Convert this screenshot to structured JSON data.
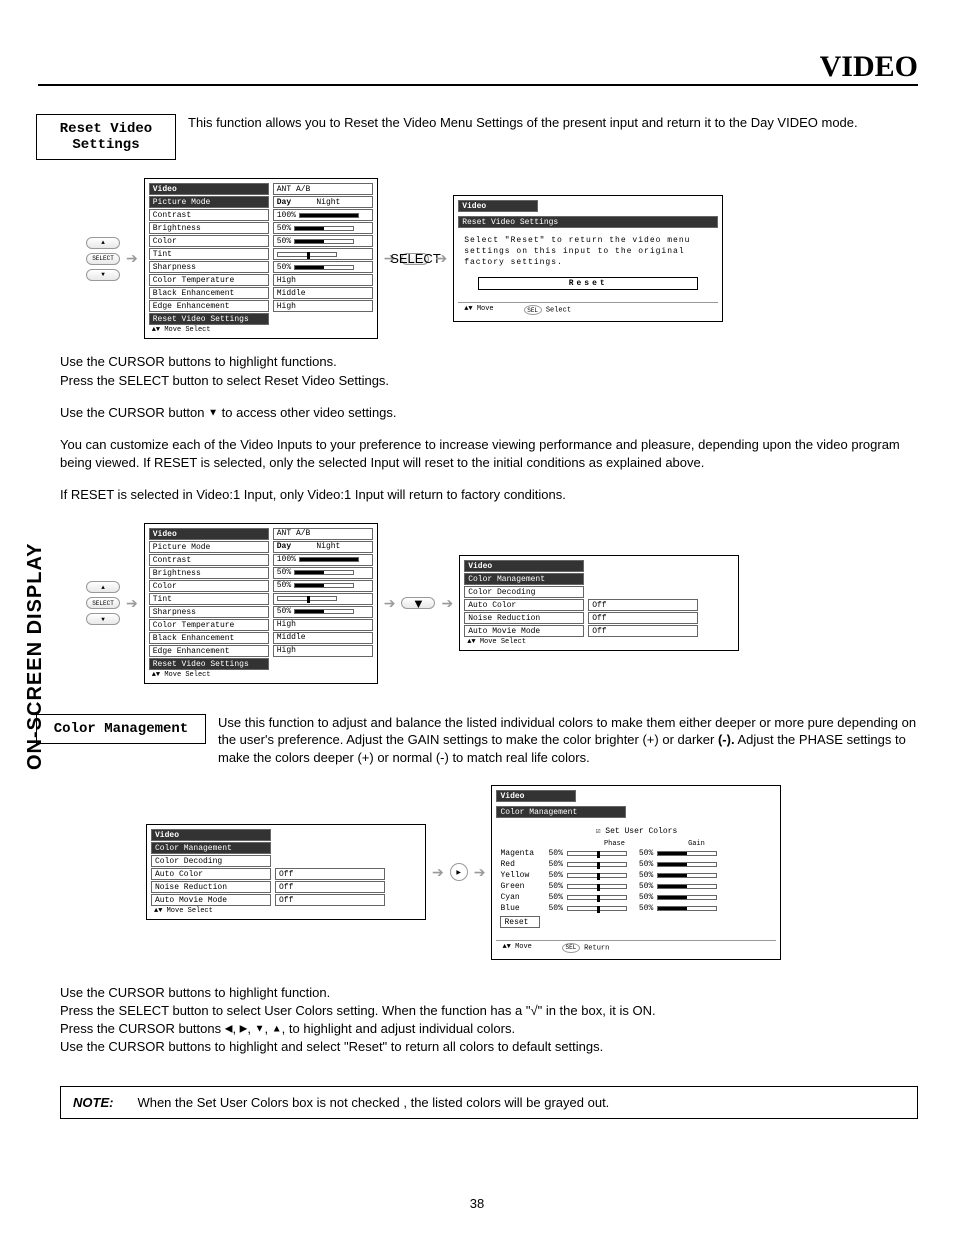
{
  "page": {
    "title": "VIDEO",
    "sidebar": "ON-SCREEN DISPLAY",
    "number": "38"
  },
  "section1": {
    "heading_line1": "Reset Video",
    "heading_line2": "Settings",
    "desc": "This function allows you to Reset the Video Menu Settings of the present input and return it to the Day VIDEO mode."
  },
  "videoMenu": {
    "header": "Video",
    "ant": "ANT A/B",
    "picture_mode": "Picture Mode",
    "day": "Day",
    "night": "Night",
    "contrast": "Contrast",
    "contrast_v": "100%",
    "brightness": "Brightness",
    "brightness_v": "50%",
    "color": "Color",
    "color_v": "50%",
    "tint": "Tint",
    "sharpness": "Sharpness",
    "sharpness_v": "50%",
    "color_temp": "Color Temperature",
    "color_temp_v": "High",
    "black_enh": "Black Enhancement",
    "black_enh_v": "Middle",
    "edge_enh": "Edge Enhancement",
    "edge_enh_v": "High",
    "reset": "Reset Video Settings",
    "hint": "Move     Select"
  },
  "remote": {
    "up": "▲",
    "select": "SELECT",
    "down": "▼"
  },
  "resetDialog": {
    "header": "Video",
    "sub": "Reset Video Settings",
    "text": "Select \"Reset\" to return the video menu settings on this input to the original factory settings.",
    "button": "Reset",
    "hint_move": "Move",
    "hint_select": "Select"
  },
  "instructions1": {
    "p1": "Use the CURSOR buttons to highlight functions.",
    "p2": "Press the SELECT button to select Reset Video Settings.",
    "p3_a": "Use the CURSOR button ",
    "p3_tri": "▼",
    "p3_b": " to access other video settings.",
    "p4": "You can customize each of the Video Inputs to your preference to increase viewing performance and pleasure, depending upon the video program being viewed. If RESET is selected, only the selected Input will reset to the initial conditions as explained above.",
    "p5": "If RESET is selected in Video:1 Input, only Video:1 Input will return to factory conditions."
  },
  "cmSubmenu": {
    "header": "Video",
    "cm": "Color Management",
    "cd": "Color Decoding",
    "ac": "Auto Color",
    "ac_v": "Off",
    "nr": "Noise Reduction",
    "nr_v": "Off",
    "amm": "Auto Movie Mode",
    "amm_v": "Off",
    "hint": "Move     Select"
  },
  "section2": {
    "heading": "Color Management",
    "desc_a": "Use this function to adjust and balance the listed individual colors to make them either deeper or more pure depending on the user's preference.  Adjust the GAIN settings to make the color brighter (+) or darker ",
    "desc_b": "(-).",
    "desc_c": "  Adjust the PHASE settings to make the colors deeper (+) or normal (-) to match real life colors."
  },
  "userColors": {
    "header": "Video",
    "cm": "Color Management",
    "checkbox": "Set User Colors",
    "phase": "Phase",
    "gain": "Gain",
    "rows": [
      {
        "name": "Magenta",
        "phase": "50%",
        "gain": "50%"
      },
      {
        "name": "Red",
        "phase": "50%",
        "gain": "50%"
      },
      {
        "name": "Yellow",
        "phase": "50%",
        "gain": "50%"
      },
      {
        "name": "Green",
        "phase": "50%",
        "gain": "50%"
      },
      {
        "name": "Cyan",
        "phase": "50%",
        "gain": "50%"
      },
      {
        "name": "Blue",
        "phase": "50%",
        "gain": "50%"
      }
    ],
    "reset": "Reset",
    "hint_move": "Move",
    "hint_return": "Return"
  },
  "instructions2": {
    "p1": "Use the CURSOR buttons to highlight function.",
    "p2_a": "Press the SELECT button to select User Colors setting.  When the function has a \"",
    "p2_mark": "√",
    "p2_b": "\" in the box, it is ON.",
    "p3_a": "Press  the CURSOR buttons ",
    "p3_b": ", to highlight and adjust individual colors.",
    "p4": "Use  the CURSOR buttons to highlight and select \"Reset\" to return all colors to default settings."
  },
  "note": {
    "label": "NOTE:",
    "text": "When the Set User Colors box is not checked , the listed colors will be grayed out."
  },
  "tri": {
    "l": "◀",
    "r": "▶",
    "d": "▼",
    "u": "▲"
  }
}
